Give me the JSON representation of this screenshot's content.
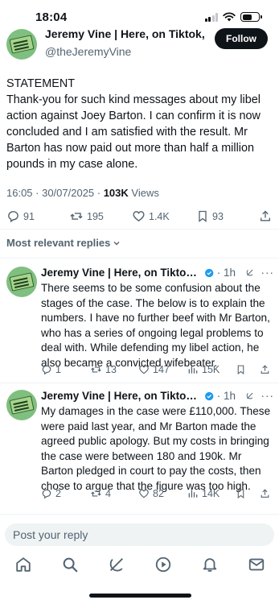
{
  "status_bar": {
    "time": "18:04"
  },
  "post": {
    "author_name": "Jeremy Vine | Here, on Tiktok, In...",
    "handle": "@theJeremyVine",
    "follow_label": "Follow",
    "text": "STATEMENT\nThank-you for such kind messages about my libel action against Joey Barton. I can confirm it is now concluded and I am satisfied with the result. Mr Barton has now paid out more than half a million pounds in my case alone.",
    "time": "16:05 · 30/07/2025 · ",
    "views_count": "103K",
    "views_label": " Views",
    "replies": "91",
    "reposts": "195",
    "likes": "1.4K",
    "bookmarks": "93"
  },
  "sort_label": "Most relevant replies",
  "replies": [
    {
      "name": "Jeremy Vine | Here, on Tiktok, Ins...",
      "time": "· 1h",
      "text": "There seems to be some confusion about the stages of the case. The below is to explain the numbers. I have no further beef with Mr Barton, who has a series of ongoing legal problems to deal with. While defending my libel action, he also became a convicted wifebeater.",
      "replies": "1",
      "reposts": "13",
      "likes": "147",
      "views": "15K"
    },
    {
      "name": "Jeremy Vine | Here, on Tiktok, Ins...",
      "time": "· 1h",
      "text": "My damages in the case were £110,000. These were paid last year, and Mr Barton made the agreed public apology. But my costs in bringing the case were between 180 and 190k. Mr Barton pledged in court to pay the costs, then chose to argue that the figure was too high.",
      "replies": "2",
      "reposts": "4",
      "likes": "82",
      "views": "14K"
    }
  ],
  "composer": {
    "placeholder": "Post your reply"
  },
  "colors": {
    "accent": "#1d9bf0",
    "text": "#0f1419",
    "secondary": "#536471"
  },
  "icons": [
    "home-icon",
    "search-icon",
    "grok-icon",
    "video-icon",
    "bell-icon",
    "mail-icon"
  ]
}
